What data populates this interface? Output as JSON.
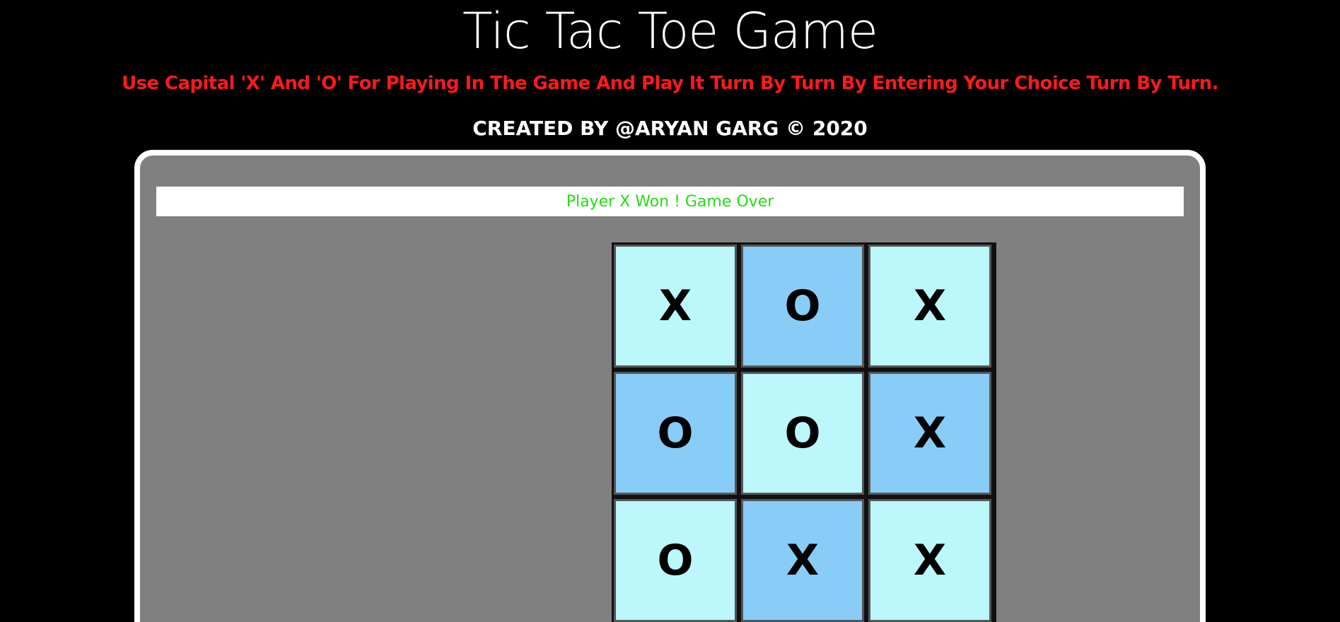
{
  "header": {
    "title": "Tic Tac Toe Game",
    "instructions": "Use Capital 'X' And 'O' For Playing In The Game And Play It Turn By Turn By Entering Your Choice Turn By Turn.",
    "credit": "CREATED BY @ARYAN GARG © 2020"
  },
  "game": {
    "status": "Player X Won ! Game Over",
    "board": [
      [
        "X",
        "O",
        "X"
      ],
      [
        "O",
        "O",
        "X"
      ],
      [
        "O",
        "X",
        "X"
      ]
    ]
  },
  "colors": {
    "background": "#000000",
    "instructions": "#ff1a1a",
    "panel": "#808080",
    "status_text": "#22dd11",
    "cell_light": "#bbf7fb",
    "cell_dark": "#87cdf8"
  }
}
